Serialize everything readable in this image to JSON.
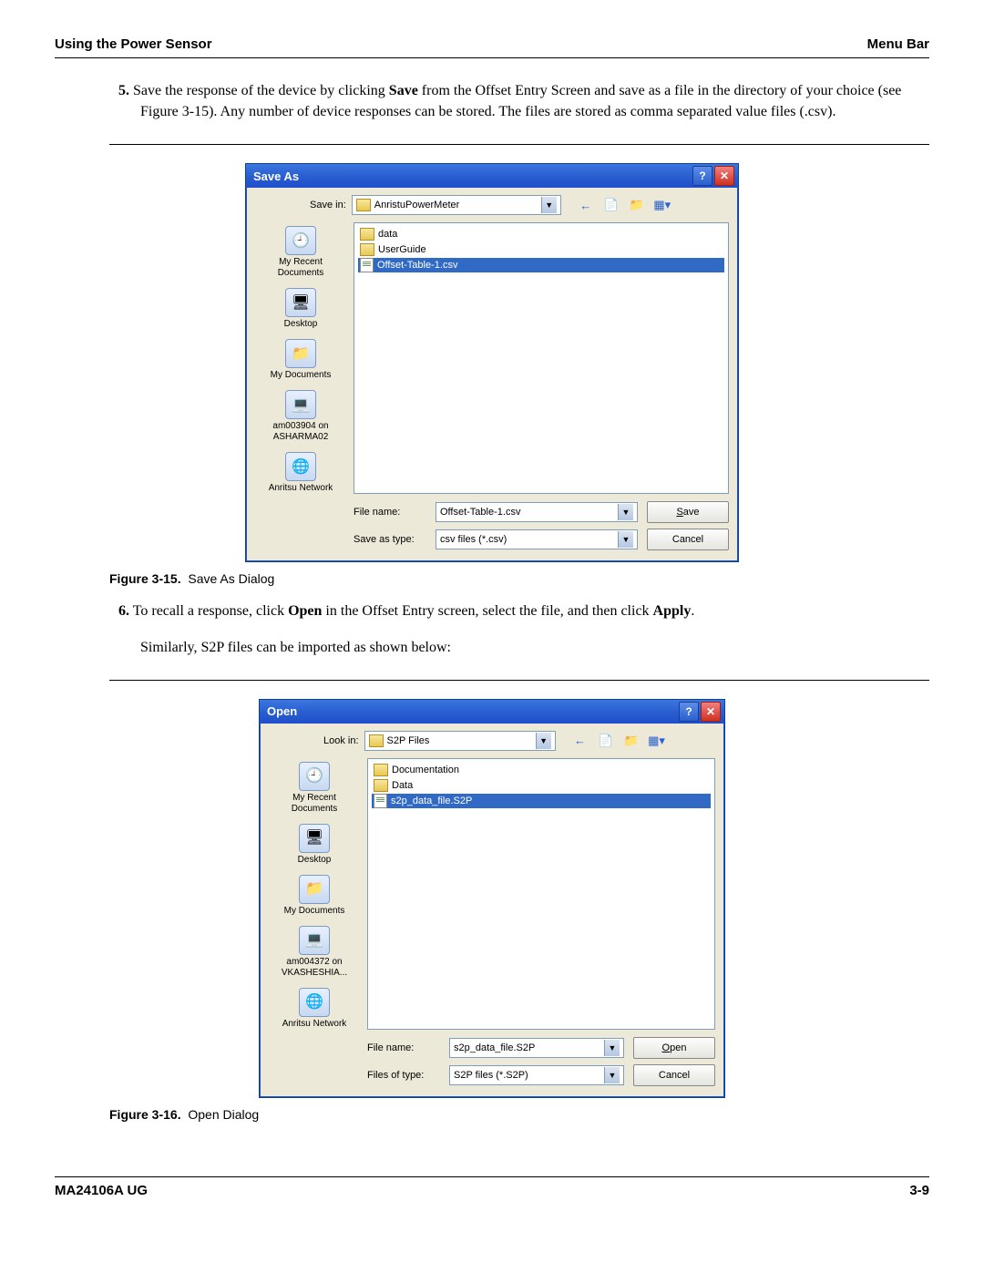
{
  "header": {
    "left": "Using the Power Sensor",
    "right": "Menu Bar"
  },
  "instructions": {
    "item5": {
      "num": "5.",
      "pre": "Save the response of the device by clicking ",
      "bold": "Save",
      "post": " from the Offset Entry Screen and save as a file in the directory of your choice (see Figure 3-15). Any number of device responses can be stored. The files are stored as comma separated value files (.csv)."
    },
    "item6a": {
      "num": "6.",
      "pre": "To recall a response, click ",
      "bold1": "Open",
      "mid": " in the Offset Entry screen, select the file, and then click ",
      "bold2": "Apply",
      "post": "."
    },
    "item6b": "Similarly, S2P files can be imported as shown below:"
  },
  "figure15": {
    "label": "Figure 3-15.",
    "caption": "Save As Dialog"
  },
  "figure16": {
    "label": "Figure 3-16.",
    "caption": "Open Dialog"
  },
  "saveAs": {
    "title": "Save As",
    "lookLabel": "Save in:",
    "lookValue": "AnristuPowerMeter",
    "places": [
      "My Recent Documents",
      "Desktop",
      "My Documents",
      "am003904 on ASHARMA02",
      "Anritsu Network"
    ],
    "files": [
      {
        "name": "data",
        "type": "folder"
      },
      {
        "name": "UserGuide",
        "type": "folder"
      },
      {
        "name": "Offset-Table-1.csv",
        "type": "file",
        "selected": true
      }
    ],
    "fileNameLabel": "File name:",
    "fileNameValue": "Offset-Table-1.csv",
    "fileTypeLabel": "Save as type:",
    "fileTypeValue": "csv files (*.csv)",
    "primaryBtn": "Save",
    "cancelBtn": "Cancel"
  },
  "open": {
    "title": "Open",
    "lookLabel": "Look in:",
    "lookValue": "S2P Files",
    "places": [
      "My Recent Documents",
      "Desktop",
      "My Documents",
      "am004372 on VKASHESHIA...",
      "Anritsu Network"
    ],
    "files": [
      {
        "name": "Documentation",
        "type": "folder"
      },
      {
        "name": "Data",
        "type": "folder"
      },
      {
        "name": "s2p_data_file.S2P",
        "type": "file",
        "selected": true
      }
    ],
    "fileNameLabel": "File name:",
    "fileNameValue": "s2p_data_file.S2P",
    "fileTypeLabel": "Files of type:",
    "fileTypeValue": "S2P files (*.S2P)",
    "primaryBtn": "Open",
    "cancelBtn": "Cancel"
  },
  "footer": {
    "left": "MA24106A UG",
    "right": "3-9"
  },
  "placeIcons": [
    "🕘",
    "🖥",
    "📁",
    "💻",
    "🌐"
  ]
}
